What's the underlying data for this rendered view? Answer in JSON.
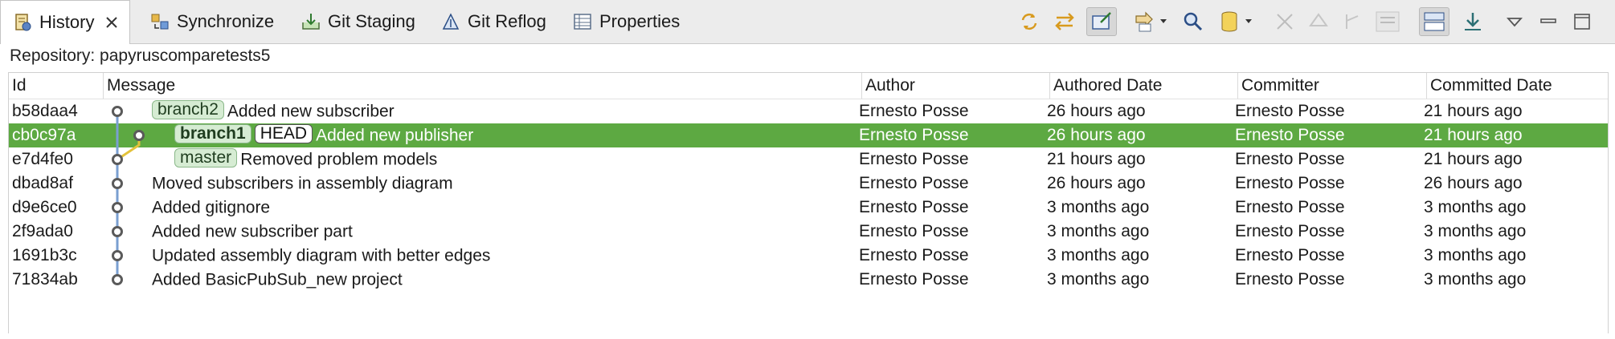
{
  "tabs": [
    {
      "label": "History",
      "icon": "history-icon",
      "active": true
    },
    {
      "label": "Synchronize",
      "icon": "synchronize-icon"
    },
    {
      "label": "Git Staging",
      "icon": "git-staging-icon"
    },
    {
      "label": "Git Reflog",
      "icon": "git-reflog-icon"
    },
    {
      "label": "Properties",
      "icon": "properties-icon"
    }
  ],
  "toolbar_icons": [
    "refresh-icon",
    "compare-mode-icon",
    "link-selection-icon",
    "show-all-branches-icon",
    "search-icon",
    "filter-resource-icon",
    "collapse-icon",
    "view-menu-icon",
    "minimize-icon",
    "maximize-icon"
  ],
  "repository": {
    "label": "Repository: papyruscomparetests5"
  },
  "columns": [
    "Id",
    "Message",
    "Author",
    "Authored Date",
    "Committer",
    "Committed Date"
  ],
  "commits": [
    {
      "id": "b58daa4",
      "refs": [
        {
          "name": "branch2",
          "type": "branch"
        }
      ],
      "message": "Added new subscriber",
      "author": "Ernesto Posse",
      "authored": "26 hours ago",
      "committer": "Ernesto Posse",
      "committed": "21 hours ago"
    },
    {
      "id": "cb0c97a",
      "refs": [
        {
          "name": "branch1",
          "type": "branch",
          "bold": true
        },
        {
          "name": "HEAD",
          "type": "head"
        }
      ],
      "message": "Added new publisher",
      "author": "Ernesto Posse",
      "authored": "26 hours ago",
      "committer": "Ernesto Posse",
      "committed": "21 hours ago",
      "selected": true
    },
    {
      "id": "e7d4fe0",
      "refs": [
        {
          "name": "master",
          "type": "branch"
        }
      ],
      "message": "Removed problem models",
      "author": "Ernesto Posse",
      "authored": "21 hours ago",
      "committer": "Ernesto Posse",
      "committed": "21 hours ago"
    },
    {
      "id": "dbad8af",
      "refs": [],
      "message": "Moved subscribers in assembly diagram",
      "author": "Ernesto Posse",
      "authored": "26 hours ago",
      "committer": "Ernesto Posse",
      "committed": "26 hours ago"
    },
    {
      "id": "d9e6ce0",
      "refs": [],
      "message": "Added gitignore",
      "author": "Ernesto Posse",
      "authored": "3 months ago",
      "committer": "Ernesto Posse",
      "committed": "3 months ago"
    },
    {
      "id": "2f9ada0",
      "refs": [],
      "message": "Added new subscriber part",
      "author": "Ernesto Posse",
      "authored": "3 months ago",
      "committer": "Ernesto Posse",
      "committed": "3 months ago"
    },
    {
      "id": "1691b3c",
      "refs": [],
      "message": "Updated assembly diagram with better edges",
      "author": "Ernesto Posse",
      "authored": "3 months ago",
      "committer": "Ernesto Posse",
      "committed": "3 months ago"
    },
    {
      "id": "71834ab",
      "refs": [],
      "message": "Added BasicPubSub_new project",
      "author": "Ernesto Posse",
      "authored": "3 months ago",
      "committer": "Ernesto Posse",
      "committed": "3 months ago"
    }
  ],
  "colors": {
    "selection": "#5da942",
    "graph_line_main": "#7a9fd1",
    "graph_line_merge": "#e3c23a",
    "branch_label_bg": "#d6ecd3"
  }
}
